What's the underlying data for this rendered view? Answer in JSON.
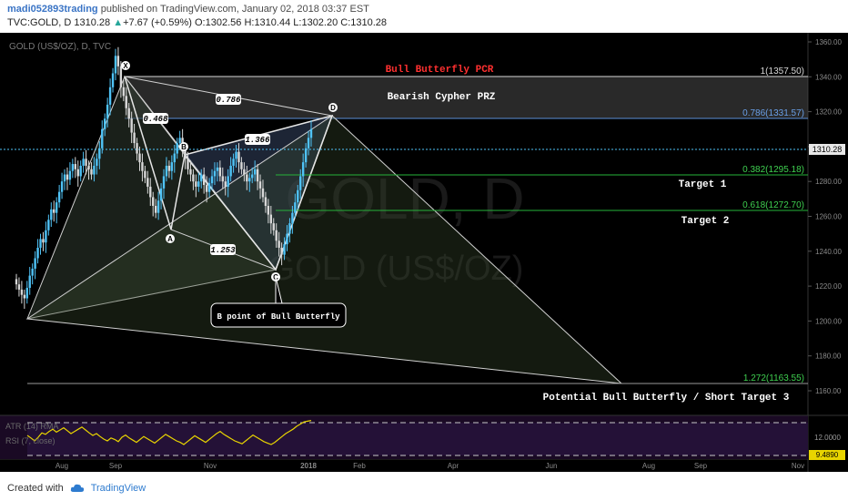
{
  "header": {
    "publisher": "madi052893trading",
    "published_text": "published on TradingView.com, January 02, 2018 03:37 EST",
    "symbol": "TVC:GOLD, D",
    "last": "1310.28",
    "change_arrow": "▲",
    "change": "+7.67 (+0.59%)",
    "o_label": "O:",
    "o": "1302.56",
    "h_label": "H:",
    "h": "1310.44",
    "l_label": "L:",
    "l": "1302.20",
    "c_label": "C:",
    "c": "1310.28"
  },
  "chart_title": "GOLD (US$/OZ), D, TVC",
  "watermark": {
    "line1": "GOLD, D",
    "line2": "GOLD (US$/OZ)"
  },
  "footer": {
    "created_with": "Created with",
    "brand": "TradingView"
  },
  "colors": {
    "background": "#000000",
    "up": "#4fc3f7",
    "down": "#d8d8d8",
    "fib_green": "#26b33a",
    "rsi_yellow": "#e8d400",
    "price_label_bg": "#e8e8e8"
  },
  "chart_data": {
    "type": "candlestick",
    "title": "GOLD (US$/OZ), D, TVC",
    "y_axis_ticks": [
      "1360.00",
      "1340.00",
      "1320.00",
      "1300.00",
      "1280.00",
      "1260.00",
      "1240.00",
      "1220.00",
      "1200.00",
      "1180.00",
      "1160.00"
    ],
    "ylim": [
      1151,
      1368
    ],
    "x_axis_ticks": [
      "Aug",
      "Sep",
      "Nov",
      "2018",
      "Feb",
      "Apr",
      "Jun",
      "Aug",
      "Sep",
      "Nov"
    ],
    "last_price_label": "1310.28",
    "pattern_points": [
      {
        "label": "X",
        "date": "2017-09-08",
        "price": 1357.5
      },
      {
        "label": "A",
        "date": "2017-10-06",
        "price": 1261
      },
      {
        "label": "B",
        "date": "2017-10-16",
        "price": 1306
      },
      {
        "label": "C",
        "date": "2017-12-12",
        "price": 1237
      },
      {
        "label": "D",
        "date": "2018-01-20",
        "price": 1331.6
      }
    ],
    "ratios": [
      "0.786",
      "0.468",
      "1.366",
      "1.253"
    ],
    "fib_levels": [
      {
        "label": "1(1357.50)",
        "price": 1357.5
      },
      {
        "label": "0.786(1331.57)",
        "price": 1331.57
      },
      {
        "label": "0.382(1295.18)",
        "price": 1295.18
      },
      {
        "label": "0.618(1272.70)",
        "price": 1272.7
      },
      {
        "label": "1.272(1163.55)",
        "price": 1163.55
      }
    ],
    "annotations": {
      "bull_butterfly_prz": "Bull Butterfly  PCR",
      "bearish_cypher_prz": "Bearish Cypher PRZ",
      "target1": "Target 1",
      "target2": "Target 2",
      "b_point": "B point of Bull Butterfly",
      "potential": "Potential Bull Butterfly / Short Target 3"
    },
    "candles_close": [
      1221,
      1218,
      1215,
      1213,
      1219,
      1226,
      1230,
      1236,
      1242,
      1247,
      1245,
      1252,
      1258,
      1264,
      1262,
      1268,
      1274,
      1280,
      1284,
      1281,
      1286,
      1290,
      1287,
      1283,
      1289,
      1293,
      1289,
      1287,
      1284,
      1289,
      1293,
      1299,
      1310,
      1316,
      1324,
      1334,
      1342,
      1352,
      1346,
      1334,
      1329,
      1322,
      1316,
      1308,
      1302,
      1296,
      1291,
      1286,
      1282,
      1277,
      1271,
      1266,
      1262,
      1269,
      1276,
      1283,
      1289,
      1286,
      1291,
      1296,
      1302,
      1305,
      1299,
      1293,
      1287,
      1284,
      1280,
      1277,
      1280,
      1284,
      1278,
      1274,
      1279,
      1283,
      1286,
      1288,
      1283,
      1280,
      1277,
      1283,
      1289,
      1293,
      1297,
      1291,
      1287,
      1284,
      1280,
      1282,
      1284,
      1287,
      1280,
      1276,
      1271,
      1266,
      1261,
      1256,
      1252,
      1246,
      1242,
      1238,
      1244,
      1250,
      1256,
      1262,
      1268,
      1275,
      1283,
      1291,
      1299,
      1305,
      1310
    ],
    "rsi_panel": {
      "label_atr": "ATR (14) RMA",
      "label_rsi": "RSI (7, close)",
      "right_label": "12.0000",
      "value_label": "9.4890",
      "values": [
        55,
        48,
        40,
        50,
        62,
        58,
        66,
        72,
        64,
        70,
        76,
        68,
        60,
        66,
        72,
        78,
        70,
        62,
        55,
        60,
        52,
        45,
        40,
        48,
        44,
        38,
        50,
        56,
        48,
        42,
        36,
        44,
        52,
        46,
        40,
        34,
        42,
        50,
        58,
        52,
        46,
        40,
        36,
        30,
        38,
        46,
        54,
        48,
        42,
        36,
        44,
        52,
        60,
        66,
        58,
        52,
        46,
        40,
        36,
        32,
        40,
        48,
        56,
        50,
        44,
        38,
        34,
        30,
        36,
        44,
        52,
        60,
        66,
        72,
        80,
        86,
        92,
        94,
        96
      ]
    }
  }
}
